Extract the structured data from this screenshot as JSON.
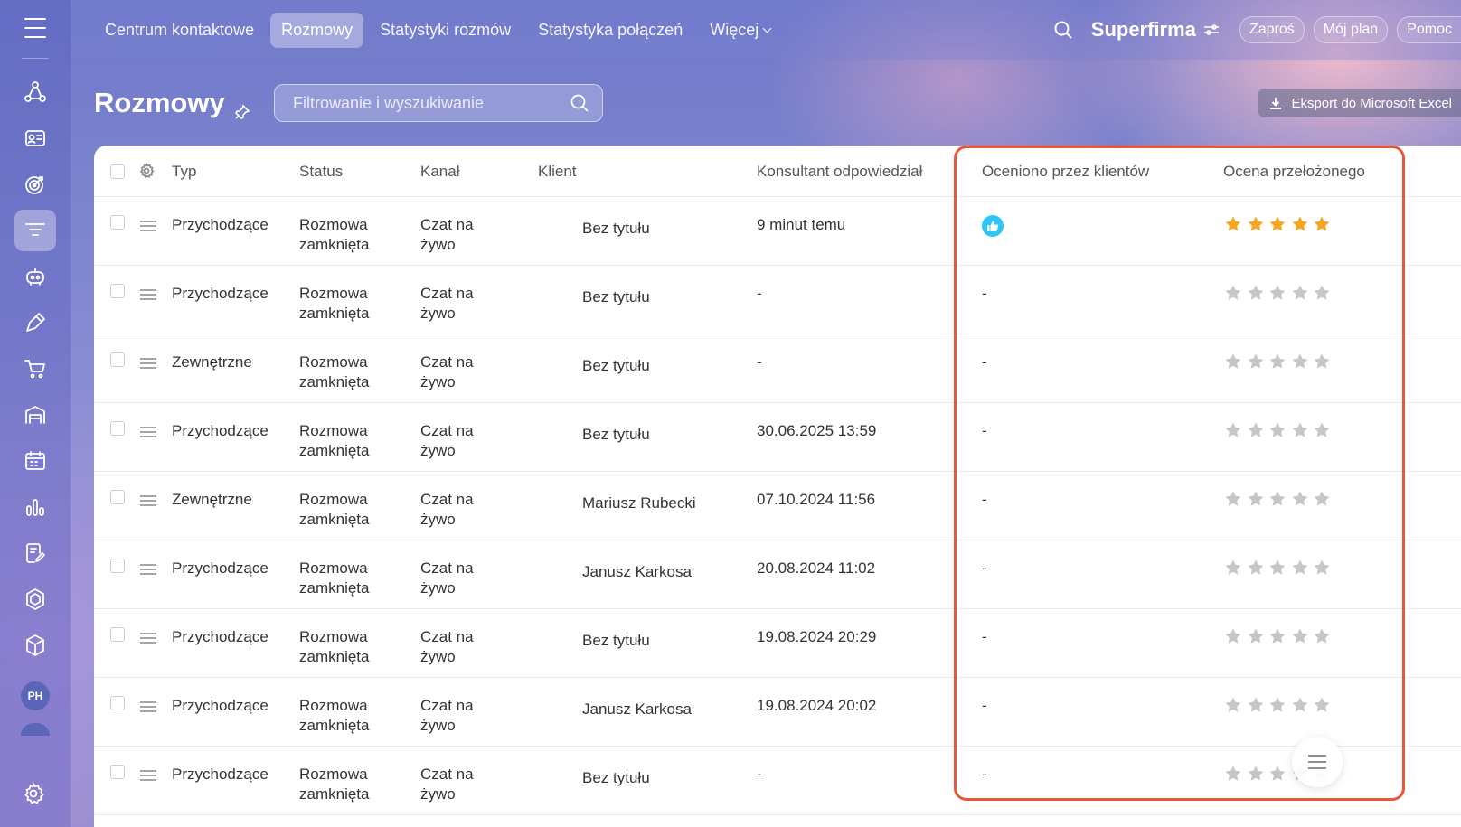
{
  "topnav": {
    "tabs": [
      {
        "label": "Centrum kontaktowe",
        "active": false
      },
      {
        "label": "Rozmowy",
        "active": true
      },
      {
        "label": "Statystyki rozmów",
        "active": false
      },
      {
        "label": "Statystyka połączeń",
        "active": false
      },
      {
        "label": "Więcej",
        "active": false,
        "has_dropdown": true
      }
    ],
    "brand": "Superfirma",
    "buttons": [
      "Zaproś",
      "Mój plan",
      "Pomoc"
    ]
  },
  "sidebar": {
    "icons": [
      "hierarchy-icon",
      "contact-card-icon",
      "target-icon",
      "filter-icon",
      "robot-icon",
      "pen-icon",
      "cart-icon",
      "warehouse-icon",
      "calendar-icon",
      "bar-chart-icon",
      "document-edit-icon",
      "hexagon-icon",
      "cube-icon"
    ],
    "active_index": 3,
    "avatar_initials": "PH"
  },
  "page": {
    "title": "Rozmowy",
    "search_placeholder": "Filtrowanie i wyszukiwanie",
    "export_label": "Eksport do Microsoft Excel"
  },
  "table": {
    "columns": [
      "Typ",
      "Status",
      "Kanał",
      "Klient",
      "Konsultant odpowiedział",
      "Oceniono przez klientów",
      "Ocena przełożonego"
    ],
    "rows": [
      {
        "typ": "Przychodzące",
        "status": [
          "Rozmowa",
          "zamknięta"
        ],
        "kanal": [
          "Czat na",
          "żywo"
        ],
        "klient": "Bez tytułu",
        "konsultant": "9 minut temu",
        "ocena_klienta": "like",
        "ocena_przelozonego": 5
      },
      {
        "typ": "Przychodzące",
        "status": [
          "Rozmowa",
          "zamknięta"
        ],
        "kanal": [
          "Czat na",
          "żywo"
        ],
        "klient": "Bez tytułu",
        "konsultant": "-",
        "ocena_klienta": "-",
        "ocena_przelozonego": 0
      },
      {
        "typ": "Zewnętrzne",
        "status": [
          "Rozmowa",
          "zamknięta"
        ],
        "kanal": [
          "Czat na",
          "żywo"
        ],
        "klient": "Bez tytułu",
        "konsultant": "-",
        "ocena_klienta": "-",
        "ocena_przelozonego": 0
      },
      {
        "typ": "Przychodzące",
        "status": [
          "Rozmowa",
          "zamknięta"
        ],
        "kanal": [
          "Czat na",
          "żywo"
        ],
        "klient": "Bez tytułu",
        "konsultant": "30.06.2025 13:59",
        "ocena_klienta": "-",
        "ocena_przelozonego": 0
      },
      {
        "typ": "Zewnętrzne",
        "status": [
          "Rozmowa",
          "zamknięta"
        ],
        "kanal": [
          "Czat na",
          "żywo"
        ],
        "klient": "Mariusz Rubecki",
        "konsultant": "07.10.2024 11:56",
        "ocena_klienta": "-",
        "ocena_przelozonego": 0
      },
      {
        "typ": "Przychodzące",
        "status": [
          "Rozmowa",
          "zamknięta"
        ],
        "kanal": [
          "Czat na",
          "żywo"
        ],
        "klient": "Janusz Karkosa",
        "konsultant": "20.08.2024 11:02",
        "ocena_klienta": "-",
        "ocena_przelozonego": 0
      },
      {
        "typ": "Przychodzące",
        "status": [
          "Rozmowa",
          "zamknięta"
        ],
        "kanal": [
          "Czat na",
          "żywo"
        ],
        "klient": "Bez tytułu",
        "konsultant": "19.08.2024 20:29",
        "ocena_klienta": "-",
        "ocena_przelozonego": 0
      },
      {
        "typ": "Przychodzące",
        "status": [
          "Rozmowa",
          "zamknięta"
        ],
        "kanal": [
          "Czat na",
          "żywo"
        ],
        "klient": "Janusz Karkosa",
        "konsultant": "19.08.2024 20:02",
        "ocena_klienta": "-",
        "ocena_przelozonego": 0
      },
      {
        "typ": "Przychodzące",
        "status": [
          "Rozmowa",
          "zamknięta"
        ],
        "kanal": [
          "Czat na",
          "żywo"
        ],
        "klient": "Bez tytułu",
        "konsultant": "-",
        "ocena_klienta": "-",
        "ocena_przelozonego": 0
      }
    ]
  },
  "colors": {
    "accent_highlight": "#e8583a",
    "star_active": "#f5a623",
    "star_inactive": "#c4c6ca",
    "like_badge": "#2fc6f6"
  }
}
